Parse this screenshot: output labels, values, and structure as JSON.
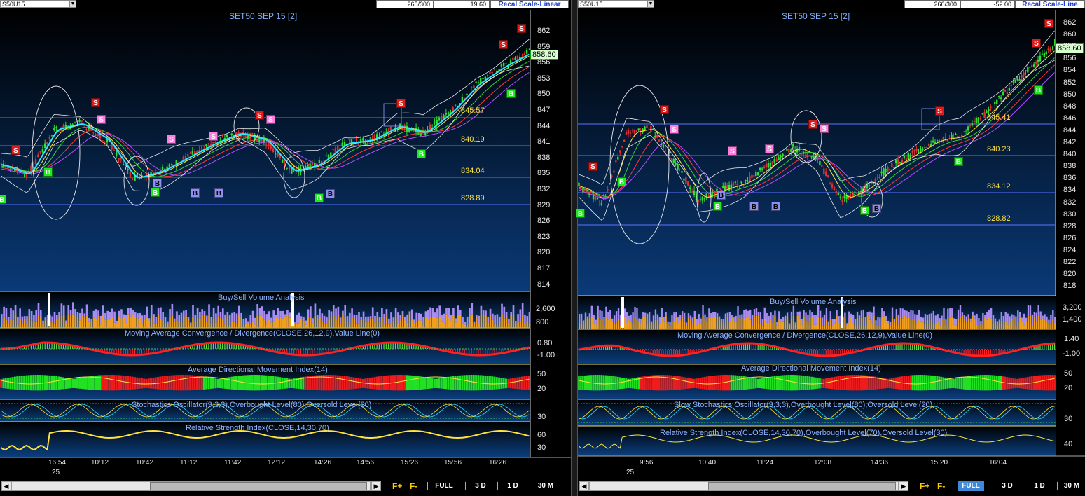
{
  "app": {
    "panes": [
      {
        "id": "left",
        "toolbar": {
          "symbol": "S50U15",
          "bars": "265/300",
          "value": "19.60",
          "recal": "Recal Scale-Linear"
        },
        "chart_title": "SET50 SEP 15   [2]",
        "last_price": "858.60",
        "price_ticks": [
          "862",
          "859",
          "856",
          "853",
          "850",
          "847",
          "844",
          "841",
          "838",
          "835",
          "832",
          "829",
          "826",
          "823",
          "820",
          "817",
          "814"
        ],
        "levels": [
          "845.57",
          "840.19",
          "834.04",
          "828.89"
        ],
        "indicators": {
          "volume": {
            "title": "Buy/Sell Volume Analysis",
            "ticks": [
              "2,600",
              "800"
            ]
          },
          "macd": {
            "title": "Moving Average Convergence / Divergence(CLOSE,26,12,9),Value Line(0)",
            "ticks": [
              "0.80",
              "-1.00"
            ]
          },
          "adx": {
            "title": "Average Directional Movement Index(14)",
            "ticks": [
              "50",
              "20"
            ]
          },
          "stoch": {
            "title": "Stochastics Oscillator(9,3,3),Overbought Level(80),Oversold Level(20)",
            "ticks": [
              "30"
            ]
          },
          "rsi": {
            "title": "Relative Strength Index(CLOSE,14,30,70)",
            "ticks": [
              "60",
              "30"
            ]
          }
        },
        "time_labels": [
          "16:54",
          "10:12",
          "10:42",
          "11:12",
          "11:42",
          "12:12",
          "14:26",
          "14:56",
          "15:26",
          "15:56",
          "16:26"
        ],
        "day_label": "25",
        "signals": {
          "sell": "S",
          "buy": "B"
        }
      },
      {
        "id": "right",
        "toolbar": {
          "symbol": "S50U15",
          "bars": "266/300",
          "value": "-52.00",
          "recal": "Recal Scale-Line"
        },
        "chart_title": "SET50 SEP 15   [2]",
        "last_price": "858.60",
        "price_ticks": [
          "862",
          "860",
          "858",
          "856",
          "854",
          "852",
          "850",
          "848",
          "846",
          "844",
          "842",
          "840",
          "838",
          "836",
          "834",
          "832",
          "830",
          "828",
          "826",
          "824",
          "822",
          "820",
          "818"
        ],
        "levels": [
          "845.41",
          "840.23",
          "834.12",
          "828.82"
        ],
        "indicators": {
          "volume": {
            "title": "Buy/Sell Volume Analysis",
            "ticks": [
              "3,200",
              "1,400"
            ]
          },
          "macd": {
            "title": "Moving Average Convergence / Divergence(CLOSE,26,12,9),Value Line(0)",
            "ticks": [
              "1.40",
              "-1.00"
            ]
          },
          "adx": {
            "title": "Average Directional Movement Index(14)",
            "ticks": [
              "50",
              "20"
            ]
          },
          "stoch": {
            "title": "Slow Stochastics Oscillator(9,3,3),Overbought Level(80),Oversold Level(20)",
            "ticks": [
              "30"
            ]
          },
          "rsi": {
            "title": "Relative Strength Index(CLOSE,14,30,70),Overbought Level(70),Oversold Level(30)",
            "ticks": [
              "40"
            ]
          }
        },
        "time_labels": [
          "9:56",
          "10:40",
          "11:24",
          "12:08",
          "14:36",
          "15:20",
          "16:04"
        ],
        "day_label": "25",
        "signals": {
          "sell": "S",
          "buy": "B"
        }
      }
    ],
    "bottom": {
      "zoom_in": "F+",
      "zoom_out": "F-",
      "timeframes": [
        "FULL",
        "3 D",
        "1 D",
        "30 M"
      ],
      "scroll_left": "◀",
      "scroll_right": "▶"
    },
    "colors": {
      "bg_top": "#000000",
      "bg_bottom": "#0a3a78",
      "level_line": "#5a73ff",
      "level_text": "#ffe23f",
      "title": "#7fb1ff",
      "sell": "#e01a1a",
      "buy": "#1ee81e"
    }
  }
}
